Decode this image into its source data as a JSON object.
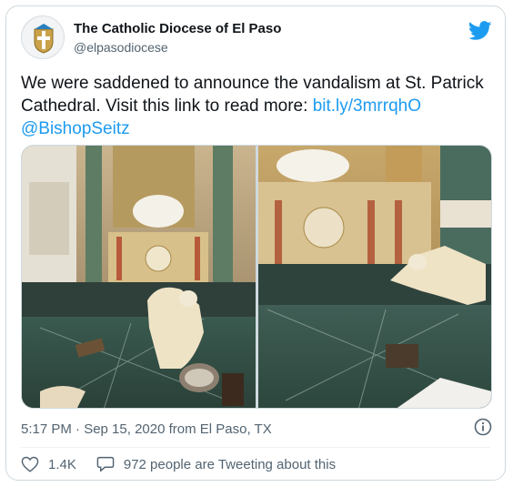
{
  "account": {
    "display_name": "The Catholic Diocese of El Paso",
    "handle": "@elpasodiocese",
    "avatar_icon": "diocese-crest-icon"
  },
  "brand": {
    "icon": "twitter-bird-icon",
    "color": "#1d9bf0"
  },
  "tweet": {
    "text": "We were saddened to announce the vandalism at St. Patrick Cathedral. Visit this link to read more: ",
    "link": "bit.ly/3mrrqhO",
    "mention": "@BishopSeitz",
    "photos": [
      {
        "icon": "cathedral-altar-photo-1"
      },
      {
        "icon": "cathedral-altar-photo-2"
      }
    ]
  },
  "meta": {
    "timestamp": "5:17 PM · Sep 15, 2020 from El Paso, TX",
    "info_icon": "info-icon"
  },
  "actions": {
    "likes": "1.4K",
    "tweeting_about": "972 people are Tweeting about this",
    "like_icon": "heart-icon",
    "reply_icon": "speech-bubble-icon"
  }
}
